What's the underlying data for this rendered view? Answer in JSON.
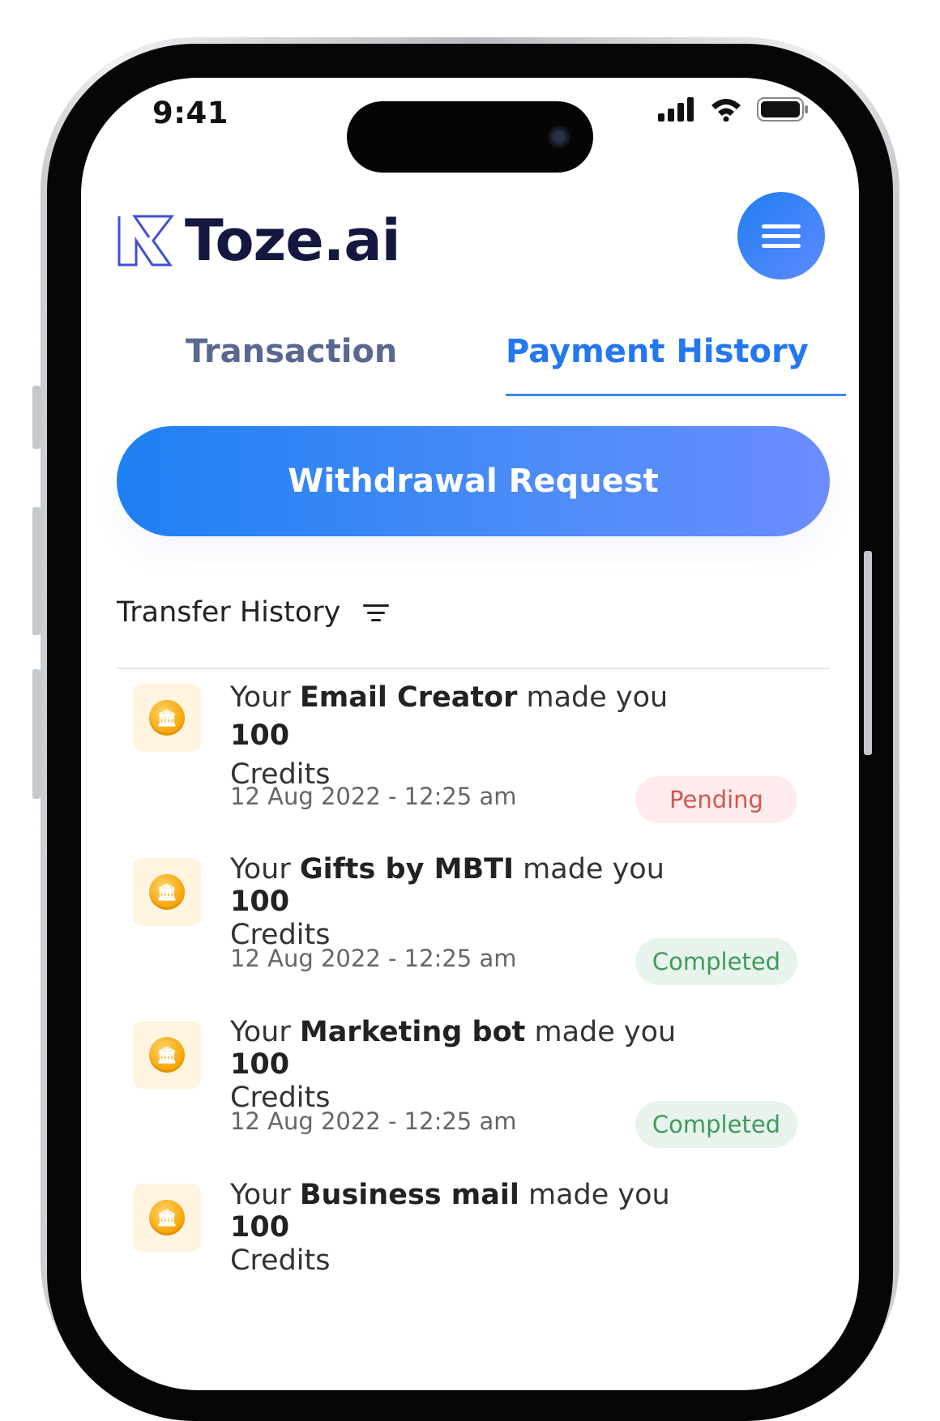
{
  "status_bar": {
    "time": "9:41"
  },
  "app": {
    "name": "Toze.ai"
  },
  "tabs": [
    {
      "label": "Transaction",
      "active": false
    },
    {
      "label": "Payment History",
      "active": true
    }
  ],
  "withdraw_button": {
    "label": "Withdrawal Request"
  },
  "section": {
    "title": "Transfer History"
  },
  "transactions": [
    {
      "prefix": "Your",
      "source": "Email Creator",
      "middle": "made you",
      "amount": "100",
      "unit": "Credits",
      "date": "12 Aug 2022 - 12:25 am",
      "status": "Pending"
    },
    {
      "prefix": "Your",
      "source": "Gifts by MBTI",
      "middle": "made you",
      "amount": "100",
      "unit": "Credits",
      "date": "12 Aug 2022 - 12:25 am",
      "status": "Completed"
    },
    {
      "prefix": "Your",
      "source": "Marketing bot",
      "middle": "made you",
      "amount": "100",
      "unit": "Credits",
      "date": "12 Aug 2022 - 12:25 am",
      "status": "Completed"
    },
    {
      "prefix": "Your",
      "source": "Business mail",
      "middle": "made you",
      "amount": "100",
      "unit": "Credits"
    }
  ],
  "colors": {
    "accent": "#2378f0",
    "brand_dark": "#14173f",
    "pending": "#d25652",
    "completed": "#3e9a5c"
  }
}
